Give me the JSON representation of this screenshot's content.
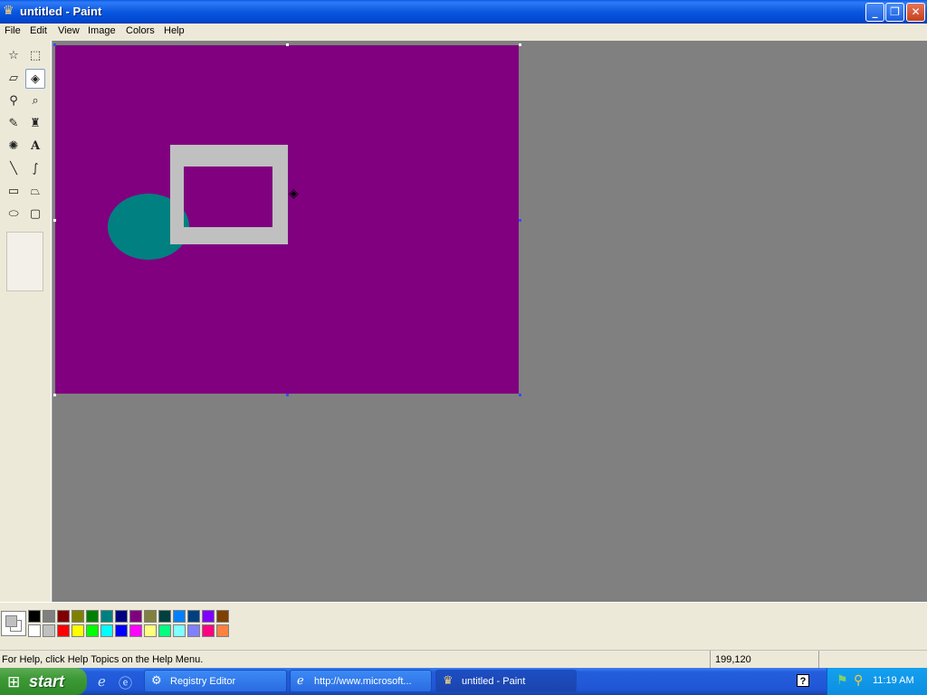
{
  "window": {
    "title": "untitled - Paint",
    "app_icon": "paint-icon",
    "buttons": [
      "minimize",
      "maximize",
      "close"
    ]
  },
  "menu": {
    "items": [
      "File",
      "Edit",
      "View",
      "Image",
      "Colors",
      "Help"
    ]
  },
  "tools": [
    {
      "name": "free-form-select",
      "icon": "☆"
    },
    {
      "name": "rect-select",
      "icon": "⬚"
    },
    {
      "name": "eraser",
      "icon": "▱"
    },
    {
      "name": "fill-with-color",
      "icon": "◈",
      "selected": true
    },
    {
      "name": "pick-color",
      "icon": "⚲"
    },
    {
      "name": "magnifier",
      "icon": "⌕"
    },
    {
      "name": "pencil",
      "icon": "✎"
    },
    {
      "name": "brush",
      "icon": "♜"
    },
    {
      "name": "airbrush",
      "icon": "✺"
    },
    {
      "name": "text",
      "icon": "A"
    },
    {
      "name": "line",
      "icon": "╲"
    },
    {
      "name": "curve",
      "icon": "∫"
    },
    {
      "name": "rectangle",
      "icon": "▭"
    },
    {
      "name": "polygon",
      "icon": "⏢"
    },
    {
      "name": "ellipse",
      "icon": "⬭"
    },
    {
      "name": "rounded-rectangle",
      "icon": "▢"
    }
  ],
  "canvas": {
    "background": "#800080",
    "ellipse_color": "#008080",
    "frame_color": "#C0C0C0"
  },
  "colors": {
    "foreground": "#C0C0C0",
    "background": "#FFFFFF",
    "palette_top": [
      "#000000",
      "#808080",
      "#800000",
      "#808000",
      "#008000",
      "#008080",
      "#000080",
      "#800080",
      "#808040",
      "#004040",
      "#0080FF",
      "#004080",
      "#8000FF",
      "#804000"
    ],
    "palette_bottom": [
      "#FFFFFF",
      "#C0C0C0",
      "#FF0000",
      "#FFFF00",
      "#00FF00",
      "#00FFFF",
      "#0000FF",
      "#FF00FF",
      "#FFFF80",
      "#00FF80",
      "#80FFFF",
      "#8080FF",
      "#FF0080",
      "#FF8040"
    ]
  },
  "status": {
    "help_text": "For Help, click Help Topics on the Help Menu.",
    "coords": "199,120"
  },
  "taskbar": {
    "start_label": "start",
    "tasks": [
      {
        "label": "Registry Editor",
        "icon": "registry-icon"
      },
      {
        "label": "http://www.microsoft...",
        "icon": "ie-icon"
      },
      {
        "label": "untitled - Paint",
        "icon": "paint-icon",
        "active": true
      }
    ],
    "clock": "11:19 AM"
  }
}
